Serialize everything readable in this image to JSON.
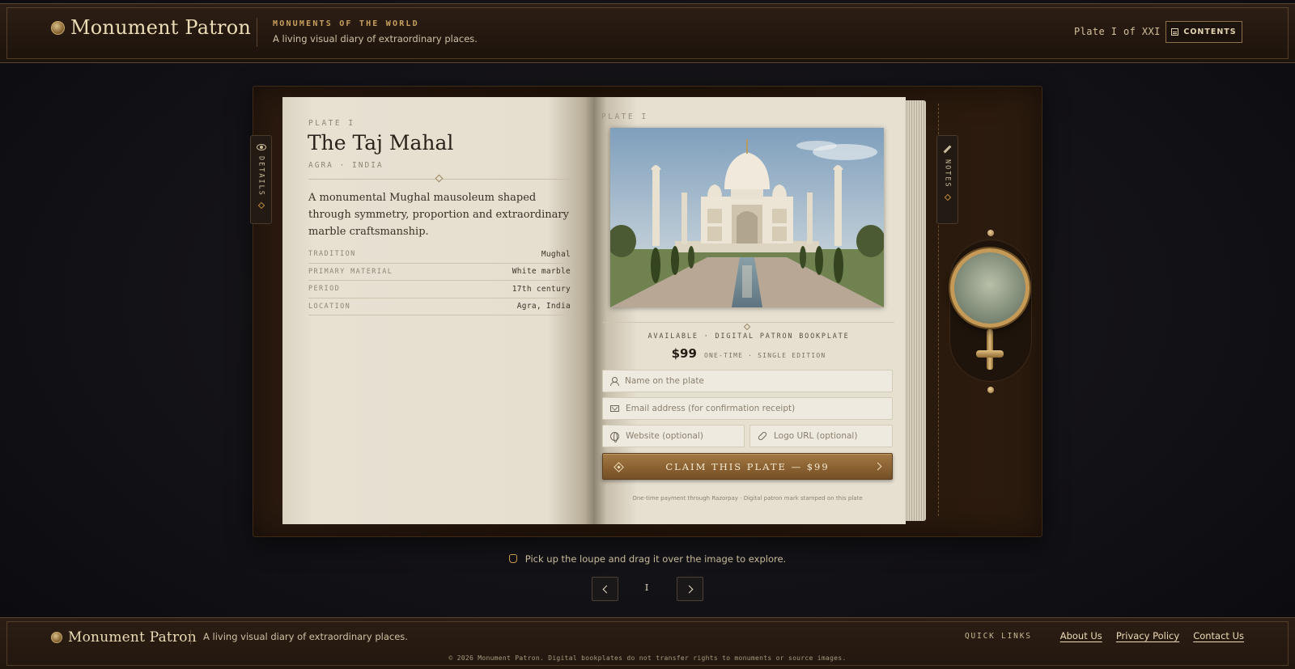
{
  "header": {
    "brand": "Monument Patron",
    "kicker": "MONUMENTS OF THE WORLD",
    "tagline": "A living visual diary of extraordinary places.",
    "plate_counter": "Plate I of XXI",
    "contents_label": "CONTENTS"
  },
  "side_tabs": {
    "details": "DETAILS",
    "notes": "NOTES"
  },
  "plate": {
    "kicker": "PLATE I",
    "title": "The Taj Mahal",
    "location": "AGRA · INDIA",
    "description": "A monumental Mughal mausoleum shaped through symmetry, proportion and extraordinary marble craftsmanship.",
    "facts": [
      {
        "key": "TRADITION",
        "value": "Mughal"
      },
      {
        "key": "PRIMARY MATERIAL",
        "value": "White marble"
      },
      {
        "key": "PERIOD",
        "value": "17th century"
      },
      {
        "key": "LOCATION",
        "value": "Agra, India"
      }
    ]
  },
  "purchase": {
    "kicker": "PLATE I",
    "availability": "AVAILABLE · DIGITAL PATRON BOOKPLATE",
    "price": "$99",
    "price_note": "ONE-TIME · SINGLE EDITION",
    "name_placeholder": "Name on the plate",
    "email_placeholder": "Email address (for confirmation receipt)",
    "website_placeholder": "Website (optional)",
    "logo_placeholder": "Logo URL (optional)",
    "claim_label": "CLAIM THIS PLATE — $99",
    "fineprint": "One-time payment through Razorpay · Digital patron mark stamped on this plate"
  },
  "hint": "Pick up the loupe and drag it over the image to explore.",
  "pager": {
    "current": "I"
  },
  "footer": {
    "brand": "Monument Patron",
    "tagline": "A living visual diary of extraordinary places.",
    "quick_links_label": "QUICK LINKS",
    "links": [
      "About Us",
      "Privacy Policy",
      "Contact Us"
    ],
    "copyright": "© 2026 Monument Patron. Digital bookplates do not transfer rights to monuments or source images."
  },
  "colors": {
    "accent_gold": "#c9a15e",
    "button_bronze": "#8a6132",
    "paper": "#e6e0d1",
    "leather": "#241810"
  }
}
